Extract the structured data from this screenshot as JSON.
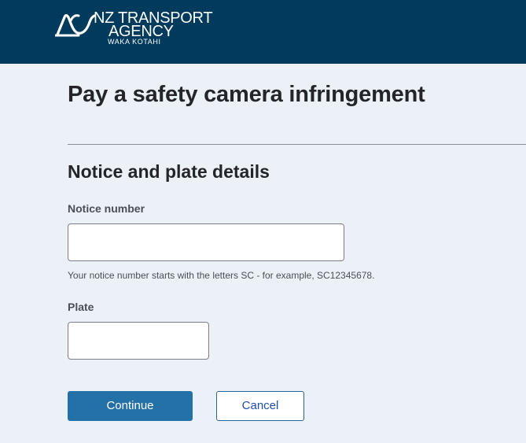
{
  "header": {
    "brand_line1": "NZ TRANSPORT",
    "brand_line2": "AGENCY",
    "brand_line3": "WAKA KOTAHI",
    "background_color": "#003a5c"
  },
  "page": {
    "title": "Pay a safety camera infringement"
  },
  "form": {
    "section_title": "Notice and plate details",
    "notice_label": "Notice number",
    "notice_value": "",
    "notice_hint": "Your notice number starts with the letters SC - for example, SC12345678.",
    "plate_label": "Plate",
    "plate_value": ""
  },
  "actions": {
    "continue_label": "Continue",
    "cancel_label": "Cancel",
    "primary_color": "#2471a8"
  }
}
